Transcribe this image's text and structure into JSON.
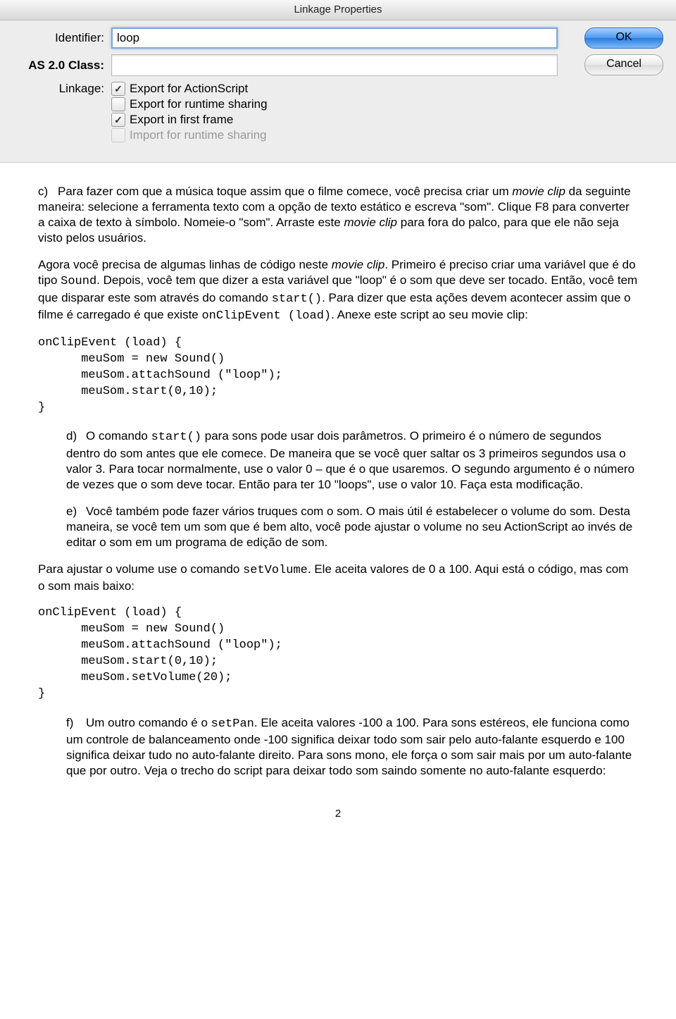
{
  "dialog": {
    "title": "Linkage Properties",
    "labels": {
      "identifier": "Identifier:",
      "asclass": "AS 2.0 Class:",
      "linkage": "Linkage:"
    },
    "fields": {
      "identifier_value": "loop",
      "asclass_value": ""
    },
    "checkboxes": {
      "export_as": "Export for ActionScript",
      "export_runtime": "Export for runtime sharing",
      "export_first": "Export in first frame",
      "import_runtime": "Import for runtime sharing"
    },
    "buttons": {
      "ok": "OK",
      "cancel": "Cancel"
    }
  },
  "doc": {
    "c_lead": "c)",
    "c_text1": "Para fazer com que a música toque assim que o filme comece, você precisa criar um ",
    "c_movieclip": "movie clip",
    "c_text2": " da seguinte maneira: selecione a ferramenta texto com a opção de texto estático e escreva \"som\". Clique F8 para converter a caixa de texto à símbolo. Nomeie-o \"som\". Arraste este ",
    "c_text3": " para fora do palco, para que ele não seja visto pelos usuários.",
    "p2a": "Agora você precisa de algumas linhas de código neste ",
    "p2b": ". Primeiro é preciso criar uma variável que é do tipo ",
    "p2_sound": "Sound",
    "p2c": ". Depois, você tem que dizer a esta variável que \"loop\" é o som que deve ser tocado. Então, você tem que disparar este som através do comando ",
    "p2_start": "start()",
    "p2d": ".  Para dizer que esta ações devem acontecer assim que o filme é carregado é que existe ",
    "p2_onclip": "onClipEvent (load)",
    "p2e": ".  Anexe este script ao seu movie clip:",
    "code1": "onClipEvent (load) {\n      meuSom = new Sound()\n      meuSom.attachSound (\"loop\");\n      meuSom.start(0,10);\n}",
    "d_lead": "d)",
    "d_text": "O comando start() para sons pode usar dois parâmetros. O primeiro é o número de segundos dentro do som antes que ele comece. De maneira que se você quer saltar os 3 primeiros segundos usa o valor 3. Para tocar normalmente, use o valor 0 – que é o que usaremos. O segundo argumento é o número de vezes que o som deve tocar. Então para ter 10 \"loops\", use o valor 10. Faça esta modificação.",
    "d_start": "start()",
    "e_lead": "e)",
    "e_text": "Você também pode fazer vários truques com o som. O mais útil é estabelecer o volume do som. Desta maneira, se você tem um som que é bem alto, você pode ajustar o volume no seu ActionScript ao invés de editar o som em um programa de edição de som.",
    "p3a": "Para ajustar o volume use o comando ",
    "p3_setvol": "setVolume",
    "p3b": ". Ele aceita valores de 0 a 100. Aqui está o código, mas com o som mais baixo:",
    "code2": "onClipEvent (load) {\n      meuSom = new Sound()\n      meuSom.attachSound (\"loop\");\n      meuSom.start(0,10);\n      meuSom.setVolume(20);\n}",
    "f_lead": "f)",
    "f_text1": "Um outro comando é o ",
    "f_setpan": "setPan",
    "f_text2": ". Ele aceita valores -100 a 100. Para sons estéreos, ele funciona como um controle de balanceamento onde -100 significa deixar todo som sair pelo auto-falante esquerdo e 100 significa deixar tudo no auto-falante direito. Para sons mono, ele força o som sair mais por um auto-falante que por outro. Veja o trecho do script para deixar todo som saindo somente no auto-falante esquerdo:",
    "page_number": "2"
  }
}
